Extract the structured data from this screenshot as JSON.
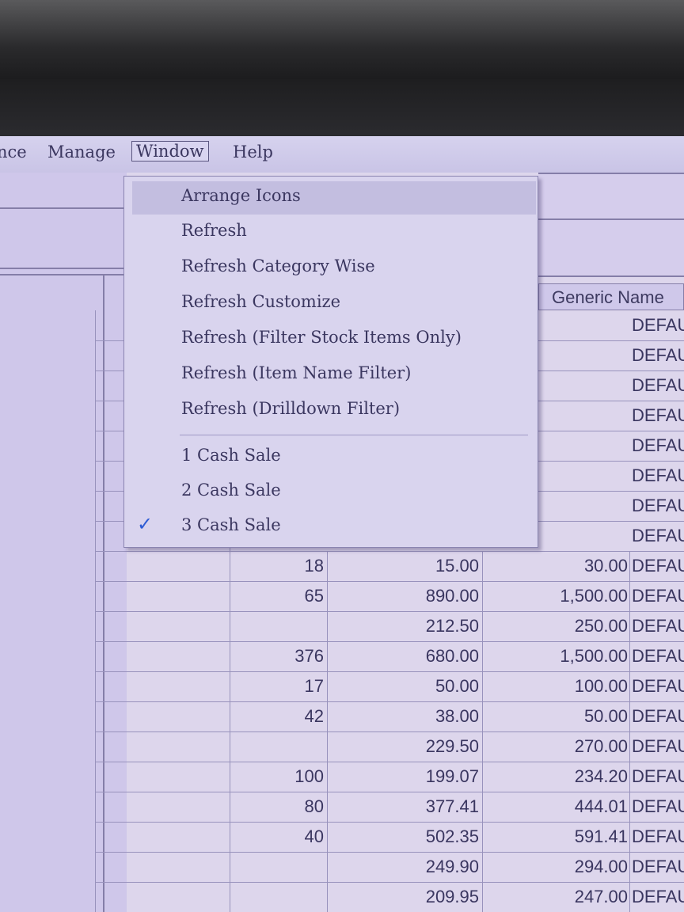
{
  "menubar": {
    "items": [
      "nce",
      "Manage",
      "Window",
      "Help"
    ]
  },
  "window_menu": {
    "items": [
      {
        "label": "Arrange Icons"
      },
      {
        "label": "Refresh"
      },
      {
        "label": "Refresh Category Wise"
      },
      {
        "label": "Refresh Customize"
      },
      {
        "label": "Refresh (Filter Stock Items Only)"
      },
      {
        "label": "Refresh (Item Name Filter)"
      },
      {
        "label": "Refresh (Drilldown Filter)"
      }
    ],
    "windows": [
      {
        "label": "1 Cash Sale",
        "checked": false
      },
      {
        "label": "2 Cash Sale",
        "checked": false
      },
      {
        "label": "3 Cash Sale",
        "checked": true
      }
    ],
    "check_symbol": "✓"
  },
  "table": {
    "header_generic": "Generic Name",
    "rows_under_menu": [
      {
        "generic": "DEFAULT GENE"
      },
      {
        "generic": "DEFAULT GENE"
      },
      {
        "generic": "DEFAULT GENE"
      },
      {
        "generic": "DEFAULT GENE"
      },
      {
        "generic": "DEFAULT GENE"
      },
      {
        "generic": "DEFAULT GENE"
      },
      {
        "generic": "DEFAULT GENE"
      },
      {
        "generic": "DEFAULT GENE"
      }
    ],
    "rows": [
      {
        "qty": "18",
        "rate": "15.00",
        "mrp": "30.00",
        "generic": "DEFAULT GENEI"
      },
      {
        "qty": "65",
        "rate": "890.00",
        "mrp": "1,500.00",
        "generic": "DEFAULT GENEI"
      },
      {
        "qty": "",
        "rate": "212.50",
        "mrp": "250.00",
        "generic": "DEFAULT GENEF"
      },
      {
        "qty": "376",
        "rate": "680.00",
        "mrp": "1,500.00",
        "generic": "DEFAULT GENEF"
      },
      {
        "qty": "17",
        "rate": "50.00",
        "mrp": "100.00",
        "generic": "DEFAULT GENEF"
      },
      {
        "qty": "42",
        "rate": "38.00",
        "mrp": "50.00",
        "generic": "DEFAULT GENEF"
      },
      {
        "qty": "",
        "rate": "229.50",
        "mrp": "270.00",
        "generic": "DEFAULT GENEF"
      },
      {
        "qty": "100",
        "rate": "199.07",
        "mrp": "234.20",
        "generic": "DEFAULT GENEF"
      },
      {
        "qty": "80",
        "rate": "377.41",
        "mrp": "444.01",
        "generic": "DEFAULT GENEF"
      },
      {
        "qty": "40",
        "rate": "502.35",
        "mrp": "591.41",
        "generic": "DEFAULT GENEF"
      },
      {
        "qty": "",
        "rate": "249.90",
        "mrp": "294.00",
        "generic": "DEFAULT GENEF"
      },
      {
        "qty": "",
        "rate": "209.95",
        "mrp": "247.00",
        "generic": "DEFAULT GENEF"
      }
    ]
  },
  "colors": {
    "screen_bg": "#ddd6ec",
    "menu_text": "#3b3760",
    "check": "#2e5cd4"
  }
}
